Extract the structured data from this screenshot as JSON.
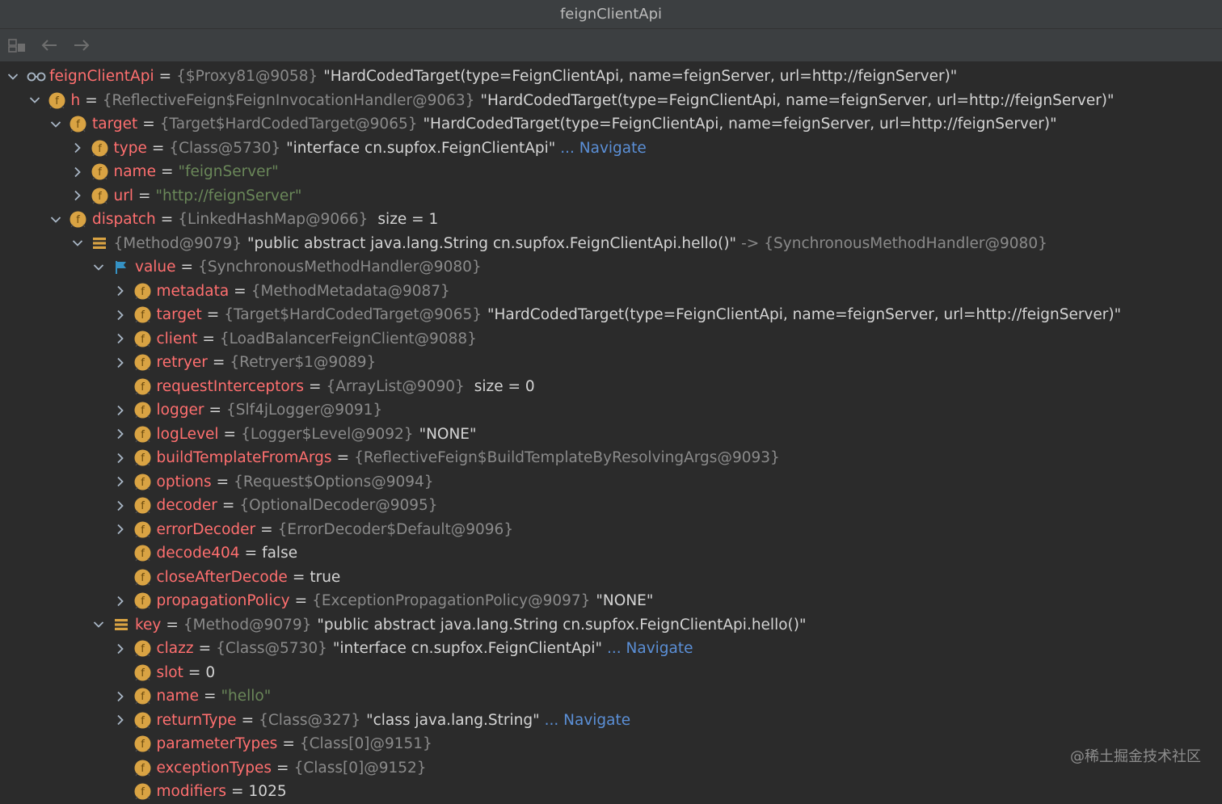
{
  "window": {
    "title": "feignClientApi"
  },
  "toolbar": {
    "layout_icon": "layout-icon",
    "back_icon": "back-arrow-icon",
    "forward_icon": "forward-arrow-icon"
  },
  "rows": [
    {
      "name": "feignClientApi",
      "ref": "{$Proxy81@9058}",
      "str": "\"HardCodedTarget(type=FeignClientApi, name=feignServer, url=http://feignServer)\""
    },
    {
      "name": "h",
      "ref": "{ReflectiveFeign$FeignInvocationHandler@9063}",
      "str": "\"HardCodedTarget(type=FeignClientApi, name=feignServer, url=http://feignServer)\""
    },
    {
      "name": "target",
      "ref": "{Target$HardCodedTarget@9065}",
      "str": "\"HardCodedTarget(type=FeignClientApi, name=feignServer, url=http://feignServer)\""
    },
    {
      "name": "type",
      "ref": "{Class@5730}",
      "str": "\"interface cn.supfox.FeignClientApi\"",
      "nav": "... Navigate"
    },
    {
      "name": "name",
      "value": "\"feignServer\""
    },
    {
      "name": "url",
      "value": "\"http://feignServer\""
    },
    {
      "name": "dispatch",
      "ref": "{LinkedHashMap@9066}",
      "size": "size = 1"
    },
    {
      "ref": "{Method@9079}",
      "str": "\"public abstract java.lang.String cn.supfox.FeignClientApi.hello()\"",
      "arrow": "->",
      "ref2": "{SynchronousMethodHandler@9080}"
    },
    {
      "name": "value",
      "ref": "{SynchronousMethodHandler@9080}"
    },
    {
      "name": "metadata",
      "ref": "{MethodMetadata@9087}"
    },
    {
      "name": "target",
      "ref": "{Target$HardCodedTarget@9065}",
      "str": "\"HardCodedTarget(type=FeignClientApi, name=feignServer, url=http://feignServer)\""
    },
    {
      "name": "client",
      "ref": "{LoadBalancerFeignClient@9088}"
    },
    {
      "name": "retryer",
      "ref": "{Retryer$1@9089}"
    },
    {
      "name": "requestInterceptors",
      "ref": "{ArrayList@9090}",
      "size": "size = 0"
    },
    {
      "name": "logger",
      "ref": "{Slf4jLogger@9091}"
    },
    {
      "name": "logLevel",
      "ref": "{Logger$Level@9092}",
      "str": "\"NONE\""
    },
    {
      "name": "buildTemplateFromArgs",
      "ref": "{ReflectiveFeign$BuildTemplateByResolvingArgs@9093}"
    },
    {
      "name": "options",
      "ref": "{Request$Options@9094}"
    },
    {
      "name": "decoder",
      "ref": "{OptionalDecoder@9095}"
    },
    {
      "name": "errorDecoder",
      "ref": "{ErrorDecoder$Default@9096}"
    },
    {
      "name": "decode404",
      "plain": "false"
    },
    {
      "name": "closeAfterDecode",
      "plain": "true"
    },
    {
      "name": "propagationPolicy",
      "ref": "{ExceptionPropagationPolicy@9097}",
      "str": "\"NONE\""
    },
    {
      "name": "key",
      "ref": "{Method@9079}",
      "str": "\"public abstract java.lang.String cn.supfox.FeignClientApi.hello()\""
    },
    {
      "name": "clazz",
      "ref": "{Class@5730}",
      "str": "\"interface cn.supfox.FeignClientApi\"",
      "nav": "... Navigate"
    },
    {
      "name": "slot",
      "plain": "0"
    },
    {
      "name": "name",
      "value": "\"hello\""
    },
    {
      "name": "returnType",
      "ref": "{Class@327}",
      "str": "\"class java.lang.String\"",
      "nav": "... Navigate"
    },
    {
      "name": "parameterTypes",
      "ref": "{Class[0]@9151}"
    },
    {
      "name": "exceptionTypes",
      "ref": "{Class[0]@9152}"
    },
    {
      "name": "modifiers",
      "plain": "1025"
    }
  ],
  "equals": "=",
  "watermark": "@稀土掘金技术社区"
}
